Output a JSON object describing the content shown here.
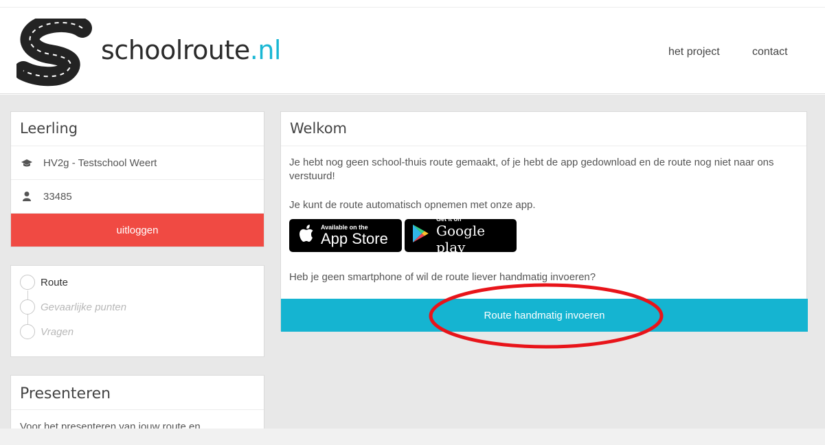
{
  "site": {
    "logo_name": "schoolroute",
    "logo_tld": ".nl",
    "nav": [
      {
        "label": "het project"
      },
      {
        "label": "contact"
      }
    ]
  },
  "student_panel": {
    "title": "Leerling",
    "class_school": "HV2g - Testschool Weert",
    "student_id": "33485",
    "logout_label": "uitloggen",
    "logout_color": "#f04a43"
  },
  "steps": [
    {
      "label": "Route",
      "state": "active"
    },
    {
      "label": "Gevaarlijke punten",
      "state": "disabled"
    },
    {
      "label": "Vragen",
      "state": "disabled"
    }
  ],
  "present_panel": {
    "title": "Presenteren",
    "body": "Voor het presenteren van jouw route en"
  },
  "welcome_panel": {
    "title": "Welkom",
    "paragraph1": "Je hebt nog geen school-thuis route gemaakt, of je hebt de app gedownload en de route nog niet naar ons verstuurd!",
    "paragraph2": "Je kunt de route automatisch opnemen met onze app.",
    "app_store": {
      "small": "Available on the",
      "big": "App Store",
      "icon": "apple-icon"
    },
    "google_play": {
      "small": "Get it on",
      "big": "Google play",
      "icon": "google-play-icon"
    },
    "paragraph3": "Heb je geen smartphone of wil de route liever handmatig invoeren?",
    "route_button_label": "Route handmatig invoeren",
    "accent_color": "#15b4d1"
  }
}
